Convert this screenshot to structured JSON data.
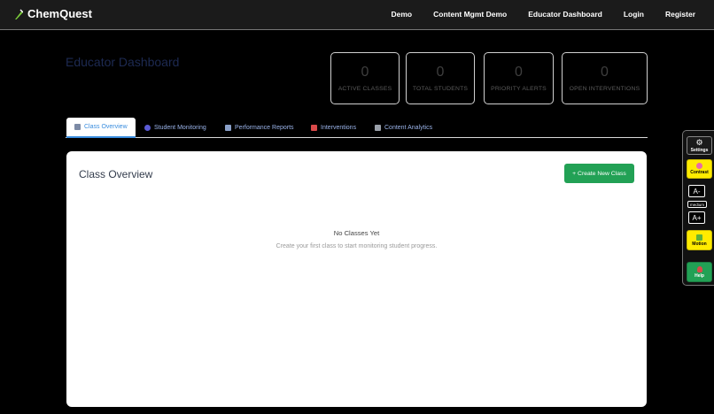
{
  "brand": {
    "name": "ChemQuest",
    "icon": "flask-icon"
  },
  "nav": {
    "items": [
      {
        "label": "Demo"
      },
      {
        "label": "Content Mgmt Demo"
      },
      {
        "label": "Educator Dashboard"
      },
      {
        "label": "Login"
      },
      {
        "label": "Register"
      }
    ]
  },
  "page": {
    "title": "Educator Dashboard"
  },
  "stats": [
    {
      "value": "0",
      "label": "ACTIVE CLASSES"
    },
    {
      "value": "0",
      "label": "TOTAL STUDENTS"
    },
    {
      "value": "0",
      "label": "PRIORITY ALERTS"
    },
    {
      "value": "0",
      "label": "OPEN INTERVENTIONS"
    }
  ],
  "tabs": [
    {
      "label": "Class Overview",
      "icon": "clipboard-icon",
      "icon_color": "#7c8aa5",
      "active": true
    },
    {
      "label": "Student Monitoring",
      "icon": "users-icon",
      "icon_color": "#5b5bd6"
    },
    {
      "label": "Performance Reports",
      "icon": "chart-icon",
      "icon_color": "#8aa0c8"
    },
    {
      "label": "Interventions",
      "icon": "alert-icon",
      "icon_color": "#d94a4a"
    },
    {
      "label": "Content Analytics",
      "icon": "books-icon",
      "icon_color": "#9aa0aa"
    }
  ],
  "panel": {
    "title": "Class Overview",
    "create_button": "+ Create New Class",
    "empty_title": "No Classes Yet",
    "empty_subtitle": "Create your first class to start monitoring student progress."
  },
  "accessibility": {
    "settings": "Settings",
    "contrast": "Contrast",
    "font_decrease": "A-",
    "font_size": "medium",
    "font_increase": "A+",
    "motion": "Motion",
    "help": "Help"
  },
  "colors": {
    "accent_green": "#22a155",
    "tab_active": "#3a8dde",
    "toolbar_yellow": "#ffeb00"
  }
}
